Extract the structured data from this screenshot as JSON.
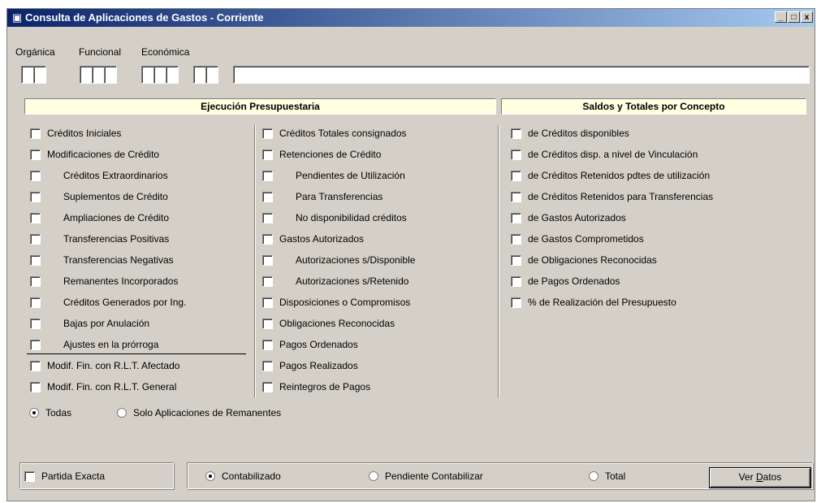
{
  "window": {
    "title": "Consulta de Aplicaciones de Gastos - Corriente",
    "min_label": "_",
    "max_label": "□",
    "close_label": "x"
  },
  "filters": {
    "organica_label": "Orgánica",
    "funcional_label": "Funcional",
    "economica_label": "Económica",
    "description_value": ""
  },
  "sections": {
    "ejecucion_title": "Ejecución Presupuestaria",
    "saldos_title": "Saldos y Totales por Concepto"
  },
  "col1": [
    {
      "label": "Créditos Iniciales",
      "indent": false,
      "checked": false
    },
    {
      "label": "Modificaciones de Crédito",
      "indent": false,
      "checked": false
    },
    {
      "label": "Créditos Extraordinarios",
      "indent": true,
      "checked": false
    },
    {
      "label": "Suplementos de Crédito",
      "indent": true,
      "checked": false
    },
    {
      "label": "Ampliaciones de Crédito",
      "indent": true,
      "checked": false
    },
    {
      "label": "Transferencias Positivas",
      "indent": true,
      "checked": false
    },
    {
      "label": "Transferencias Negativas",
      "indent": true,
      "checked": false
    },
    {
      "label": "Remanentes Incorporados",
      "indent": true,
      "checked": false
    },
    {
      "label": "Créditos Generados por Ing.",
      "indent": true,
      "checked": false
    },
    {
      "label": "Bajas por Anulación",
      "indent": true,
      "checked": false
    },
    {
      "label": "Ajustes en la prórroga",
      "indent": true,
      "checked": false
    },
    {
      "label": "Modif. Fin. con R.L.T. Afectado",
      "indent": false,
      "checked": false
    },
    {
      "label": "Modif. Fin. con R.L.T. General",
      "indent": false,
      "checked": false
    }
  ],
  "col2": [
    {
      "label": "Créditos Totales consignados",
      "indent": false,
      "checked": false
    },
    {
      "label": "Retenciones de Crédito",
      "indent": false,
      "checked": false
    },
    {
      "label": "Pendientes de Utilización",
      "indent": true,
      "checked": false
    },
    {
      "label": "Para Transferencias",
      "indent": true,
      "checked": false
    },
    {
      "label": "No disponibilidad créditos",
      "indent": true,
      "checked": false
    },
    {
      "label": "Gastos Autorizados",
      "indent": false,
      "checked": false
    },
    {
      "label": "Autorizaciones s/Disponible",
      "indent": true,
      "checked": false
    },
    {
      "label": "Autorizaciones s/Retenido",
      "indent": true,
      "checked": false
    },
    {
      "label": "Disposiciones o Compromisos",
      "indent": false,
      "checked": false
    },
    {
      "label": "Obligaciones Reconocidas",
      "indent": false,
      "checked": false
    },
    {
      "label": "Pagos Ordenados",
      "indent": false,
      "checked": false
    },
    {
      "label": "Pagos Realizados",
      "indent": false,
      "checked": false
    },
    {
      "label": "Reintegros de Pagos",
      "indent": false,
      "checked": false
    }
  ],
  "col3": [
    {
      "label": "de Créditos disponibles",
      "checked": false
    },
    {
      "label": "de Créditos disp. a nivel de Vinculación",
      "checked": false
    },
    {
      "label": "de Créditos Retenidos pdtes de utilización",
      "checked": false
    },
    {
      "label": "de Créditos Retenidos para Transferencias",
      "checked": false
    },
    {
      "label": "de Gastos Autorizados",
      "checked": false
    },
    {
      "label": "de Gastos Comprometidos",
      "checked": false
    },
    {
      "label": "de Obligaciones Reconocidas",
      "checked": false
    },
    {
      "label": "de Pagos Ordenados",
      "checked": false
    },
    {
      "label": "% de Realización del Presupuesto",
      "checked": false
    }
  ],
  "scope": {
    "todas_label": "Todas",
    "remanentes_label": "Solo Aplicaciones de Remanentes",
    "selected": "Todas"
  },
  "footer": {
    "partida_exacta_label": "Partida Exacta",
    "partida_exacta_checked": false,
    "contabilizado_label": "Contabilizado",
    "pendiente_label": "Pendiente Contabilizar",
    "total_label": "Total",
    "selected": "Contabilizado",
    "ver_datos_prefix": "Ver ",
    "ver_datos_underlined": "D",
    "ver_datos_suffix": "atos"
  }
}
